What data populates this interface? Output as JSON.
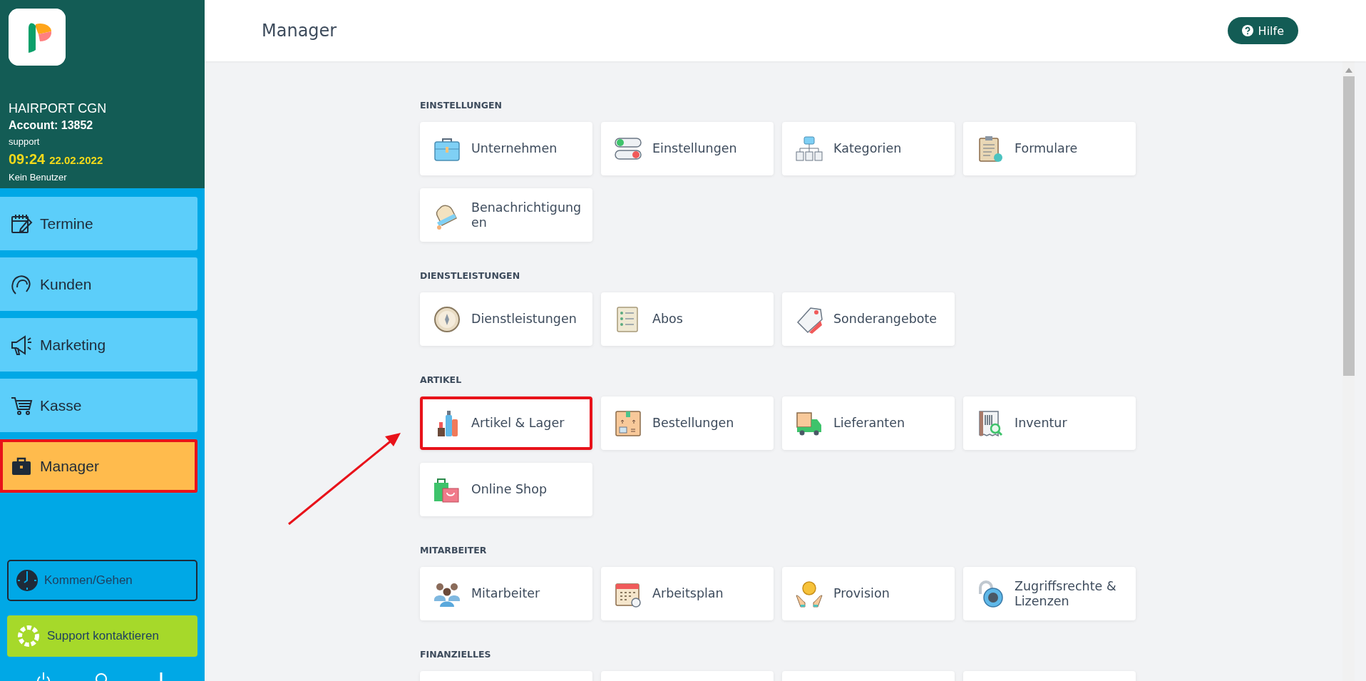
{
  "sidebar": {
    "shop": "HAIRPORT CGN",
    "account": "Account: 13852",
    "user": "support",
    "time": "09:24",
    "date": "22.02.2022",
    "status": "Kein Benutzer",
    "nav": [
      {
        "label": "Termine",
        "selected": false,
        "highlighted": false
      },
      {
        "label": "Kunden",
        "selected": false,
        "highlighted": false
      },
      {
        "label": "Marketing",
        "selected": false,
        "highlighted": false
      },
      {
        "label": "Kasse",
        "selected": false,
        "highlighted": false
      },
      {
        "label": "Manager",
        "selected": true,
        "highlighted": true
      }
    ],
    "clock_button": "Kommen/Gehen",
    "support_button": "Support kontaktieren"
  },
  "header": {
    "title": "Manager",
    "help_button": "Hilfe"
  },
  "arrow_shown": true,
  "sections": [
    {
      "title": "EINSTELLUNGEN",
      "cards": [
        {
          "kind": "link",
          "label": "Unternehmen",
          "highlighted": false
        },
        {
          "kind": "link",
          "label": "Einstellungen",
          "highlighted": false
        },
        {
          "kind": "link",
          "label": "Kategorien",
          "highlighted": false
        },
        {
          "kind": "link",
          "label": "Formulare",
          "highlighted": false
        },
        {
          "kind": "link",
          "label": "Benachrichtigungen",
          "highlighted": false
        }
      ]
    },
    {
      "title": "DIENSTLEISTUNGEN",
      "cards": [
        {
          "kind": "link",
          "label": "Dienstleistungen",
          "highlighted": false
        },
        {
          "kind": "link",
          "label": "Abos",
          "highlighted": false
        },
        {
          "kind": "link",
          "label": "Sonderangebote",
          "highlighted": false
        }
      ]
    },
    {
      "title": "ARTIKEL",
      "cards": [
        {
          "kind": "link",
          "label": "Artikel & Lager",
          "highlighted": true
        },
        {
          "kind": "link",
          "label": "Bestellungen",
          "highlighted": false
        },
        {
          "kind": "link",
          "label": "Lieferanten",
          "highlighted": false
        },
        {
          "kind": "link",
          "label": "Inventur",
          "highlighted": false
        },
        {
          "kind": "link",
          "label": "Online Shop",
          "highlighted": false
        }
      ]
    },
    {
      "title": "MITARBEITER",
      "cards": [
        {
          "kind": "link",
          "label": "Mitarbeiter",
          "highlighted": false
        },
        {
          "kind": "link",
          "label": "Arbeitsplan",
          "highlighted": false
        },
        {
          "kind": "link",
          "label": "Provision",
          "highlighted": false
        },
        {
          "kind": "link",
          "label": "Zugriffsrechte & Lizenzen",
          "highlighted": false
        }
      ]
    },
    {
      "title": "FINANZIELLES",
      "cards": [
        {
          "kind": "blank"
        },
        {
          "kind": "blank"
        },
        {
          "kind": "blank"
        },
        {
          "kind": "blank"
        }
      ]
    }
  ]
}
